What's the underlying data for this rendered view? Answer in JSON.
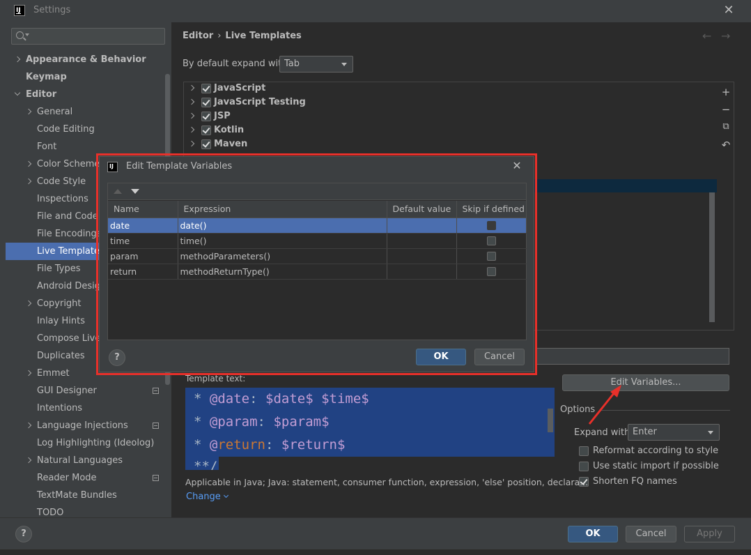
{
  "window": {
    "title": "Settings",
    "app_icon_text": "IJ"
  },
  "search": {
    "placeholder": ""
  },
  "sidebar": {
    "items": [
      {
        "label": "Appearance & Behavior",
        "level": 0,
        "bold": true,
        "chevron": "right"
      },
      {
        "label": "Keymap",
        "level": 0,
        "bold": true,
        "chevron": "none"
      },
      {
        "label": "Editor",
        "level": 0,
        "bold": true,
        "chevron": "down"
      },
      {
        "label": "General",
        "level": 1,
        "chevron": "right"
      },
      {
        "label": "Code Editing",
        "level": 1,
        "chevron": "none"
      },
      {
        "label": "Font",
        "level": 1,
        "chevron": "none"
      },
      {
        "label": "Color Scheme",
        "level": 1,
        "chevron": "right"
      },
      {
        "label": "Code Style",
        "level": 1,
        "chevron": "right"
      },
      {
        "label": "Inspections",
        "level": 1,
        "chevron": "none"
      },
      {
        "label": "File and Code",
        "level": 1,
        "chevron": "none"
      },
      {
        "label": "File Encodings",
        "level": 1,
        "chevron": "none"
      },
      {
        "label": "Live Templates",
        "level": 1,
        "chevron": "none",
        "selected": true
      },
      {
        "label": "File Types",
        "level": 1,
        "chevron": "none"
      },
      {
        "label": "Android Desig",
        "level": 1,
        "chevron": "none"
      },
      {
        "label": "Copyright",
        "level": 1,
        "chevron": "right"
      },
      {
        "label": "Inlay Hints",
        "level": 1,
        "chevron": "none"
      },
      {
        "label": "Compose Live",
        "level": 1,
        "chevron": "none"
      },
      {
        "label": "Duplicates",
        "level": 1,
        "chevron": "none"
      },
      {
        "label": "Emmet",
        "level": 1,
        "chevron": "right"
      },
      {
        "label": "GUI Designer",
        "level": 1,
        "chevron": "none",
        "module_icon": true
      },
      {
        "label": "Intentions",
        "level": 1,
        "chevron": "none"
      },
      {
        "label": "Language Injections",
        "level": 1,
        "chevron": "right",
        "module_icon": true
      },
      {
        "label": "Log Highlighting (Ideolog)",
        "level": 1,
        "chevron": "none"
      },
      {
        "label": "Natural Languages",
        "level": 1,
        "chevron": "right"
      },
      {
        "label": "Reader Mode",
        "level": 1,
        "chevron": "none",
        "module_icon": true
      },
      {
        "label": "TextMate Bundles",
        "level": 1,
        "chevron": "none"
      },
      {
        "label": "TODO",
        "level": 1,
        "chevron": "none"
      }
    ]
  },
  "breadcrumb": {
    "parent": "Editor",
    "separator": "›",
    "current": "Live Templates"
  },
  "nav": {
    "back": "←",
    "forward": "→"
  },
  "expand_default": {
    "label": "By default expand with",
    "value": "Tab"
  },
  "template_groups": [
    {
      "name": "JavaScript",
      "checked": true
    },
    {
      "name": "JavaScript Testing",
      "checked": true
    },
    {
      "name": "JSP",
      "checked": true
    },
    {
      "name": "Kotlin",
      "checked": true
    },
    {
      "name": "Maven",
      "checked": true
    }
  ],
  "toolbar": {
    "add": "+",
    "remove": "−",
    "copy": "⧉",
    "restore": "↶"
  },
  "template_text": {
    "label": "Template text:",
    "lines": [
      {
        "star": "* ",
        "tag_prefix": "@",
        "tag": "date",
        "after_tag": ": ",
        "vars": "$date$ $time$"
      },
      {
        "star": "* ",
        "tag_prefix": "@",
        "tag": "param",
        "after_tag": ": ",
        "vars": "$param$"
      },
      {
        "star": "* ",
        "tag_prefix": "@",
        "tag": "return",
        "after_tag": ": ",
        "vars": "$return$"
      },
      {
        "text": "**/"
      }
    ]
  },
  "edit_variables_button": "Edit Variables...",
  "options": {
    "title": "Options",
    "expand_with_label": "Expand with",
    "expand_with_value": "Enter",
    "checkboxes": [
      {
        "label": "Reformat according to style",
        "checked": false
      },
      {
        "label": "Use static import if possible",
        "checked": false
      },
      {
        "label": "Shorten FQ names",
        "checked": true
      }
    ]
  },
  "applicable": {
    "text": "Applicable in Java; Java: statement, consumer function, expression, 'else' position, declara...",
    "change_label": "Change"
  },
  "bottom_buttons": {
    "help": "?",
    "ok": "OK",
    "cancel": "Cancel",
    "apply": "Apply"
  },
  "dialog": {
    "title": "Edit Template Variables",
    "close": "✕",
    "columns": [
      "Name",
      "Expression",
      "Default value",
      "Skip if defined"
    ],
    "rows": [
      {
        "name": "date",
        "expression": "date()",
        "default": "",
        "skip": false,
        "selected": true
      },
      {
        "name": "time",
        "expression": "time()",
        "default": "",
        "skip": false
      },
      {
        "name": "param",
        "expression": "methodParameters()",
        "default": "",
        "skip": false
      },
      {
        "name": "return",
        "expression": "methodReturnType()",
        "default": "",
        "skip": false
      }
    ],
    "help": "?",
    "ok": "OK",
    "cancel": "Cancel"
  },
  "colors": {
    "selection": "#4b6eaf",
    "highlight_outline": "#e8302a",
    "annotation_arrow": "#e8302a",
    "link": "#589df6"
  }
}
